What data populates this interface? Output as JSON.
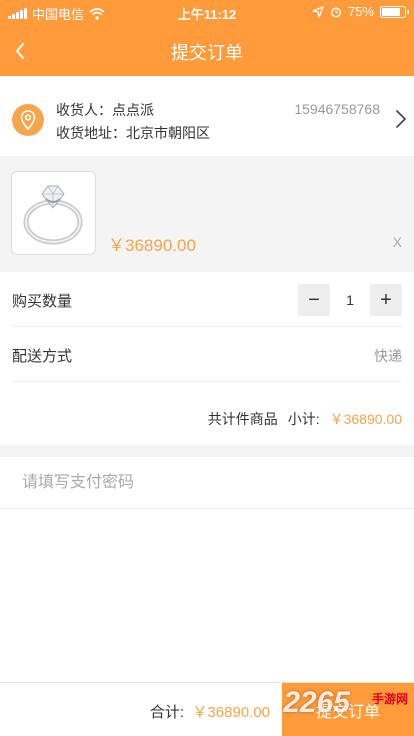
{
  "status_bar": {
    "carrier": "中国电信",
    "time": "上午11:12",
    "battery": "75%"
  },
  "nav": {
    "title": "提交订单"
  },
  "address": {
    "receiver_label": "收货人：",
    "receiver_name": "点点派",
    "phone": "15946758768",
    "address_label": "收货地址：",
    "address_value": "北京市朝阳区"
  },
  "product": {
    "price": "￥36890.00",
    "remove": "X"
  },
  "quantity": {
    "label": "购买数量",
    "value": "1",
    "minus": "−",
    "plus": "+"
  },
  "delivery": {
    "label": "配送方式",
    "value": "快递"
  },
  "summary": {
    "items_text": "共计件商品",
    "subtotal_label": "小计:",
    "subtotal_value": "￥36890.00"
  },
  "payment": {
    "placeholder": "请填写支付密码"
  },
  "footer": {
    "total_label": "合计:",
    "total_value": "￥36890.00",
    "submit_label": "提交订单"
  },
  "watermark": {
    "number": "2265",
    "site": "手游网"
  },
  "colors": {
    "accent": "#FF9B3B",
    "price": "#F5A54C"
  }
}
